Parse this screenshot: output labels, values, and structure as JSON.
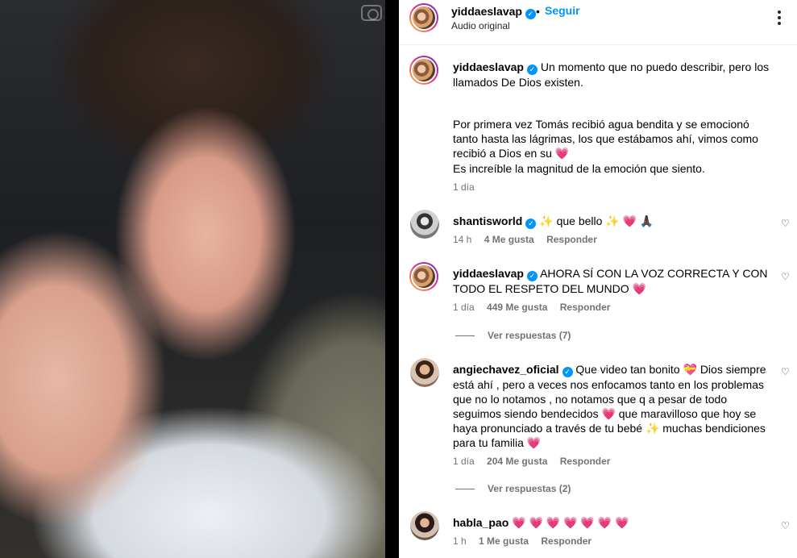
{
  "post": {
    "username": "yiddaeslavap",
    "dot": "•",
    "follow_label": "Seguir",
    "audio": "Audio original",
    "verified_mark": "✓"
  },
  "caption": {
    "username": "yiddaeslavap",
    "line1": "Un momento que no puedo describir, pero los llamados De Dios existen.",
    "line2": "Por primera vez Tomás recibió agua bendita y se emocionó tanto hasta las lágrimas, los que estábamos ahí, vimos como recibió a Dios en su",
    "line2_emoji": "💗",
    "line3": "Es increíble la magnitud de la emoción que siento.",
    "time": "1 día"
  },
  "comments": [
    {
      "username": "shantisworld",
      "text": "✨ que bello ✨ 💗 🙏🏿",
      "time": "14 h",
      "likes": "4 Me gusta",
      "reply": "Responder"
    },
    {
      "username": "yiddaeslavap",
      "text": "AHORA SÍ CON LA VOZ CORRECTA Y CON TODO EL RESPETO DEL MUNDO 💗",
      "time": "1 día",
      "likes": "449 Me gusta",
      "reply": "Responder",
      "view_replies": "Ver respuestas (7)"
    },
    {
      "username": "angiechavez_oficial",
      "text": "Que video tan bonito 💝 Dios siempre está ahí , pero a veces nos enfocamos tanto en los problemas que no lo notamos , no notamos que q a pesar de todo seguimos siendo bendecidos 💗 que maravilloso que hoy se haya pronunciado a través de tu bebé ✨ muchas bendiciones para tu familia 💗",
      "time": "1 día",
      "likes": "204 Me gusta",
      "reply": "Responder",
      "view_replies": "Ver respuestas (2)"
    },
    {
      "username": "habla_pao",
      "text": "💗 💗 💗 💗 💗 💗 💗",
      "time": "1 h",
      "likes": "1 Me gusta",
      "reply": "Responder"
    }
  ],
  "icons": {
    "heart": "♡",
    "more": "more-options-icon",
    "camera": "camera-icon"
  },
  "colors": {
    "link_blue": "#0095f6",
    "meta_gray": "#737373"
  }
}
